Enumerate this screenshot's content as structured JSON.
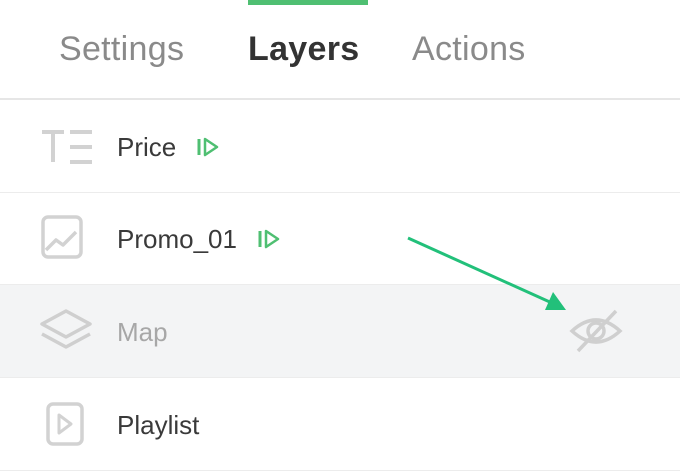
{
  "tabs": [
    {
      "label": "Settings",
      "active": false
    },
    {
      "label": "Layers",
      "active": true
    },
    {
      "label": "Actions",
      "active": false
    }
  ],
  "layers": [
    {
      "label": "Price",
      "icon": "text-icon",
      "animated": true,
      "hidden": false
    },
    {
      "label": "Promo_01",
      "icon": "image-icon",
      "animated": true,
      "hidden": false
    },
    {
      "label": "Map",
      "icon": "layers-icon",
      "animated": false,
      "hidden": true
    },
    {
      "label": "Playlist",
      "icon": "video-icon",
      "animated": false,
      "hidden": false
    }
  ],
  "colors": {
    "accent": "#4fbf72",
    "arrow": "#22c07a",
    "hidden_row_bg": "#f3f4f5"
  }
}
